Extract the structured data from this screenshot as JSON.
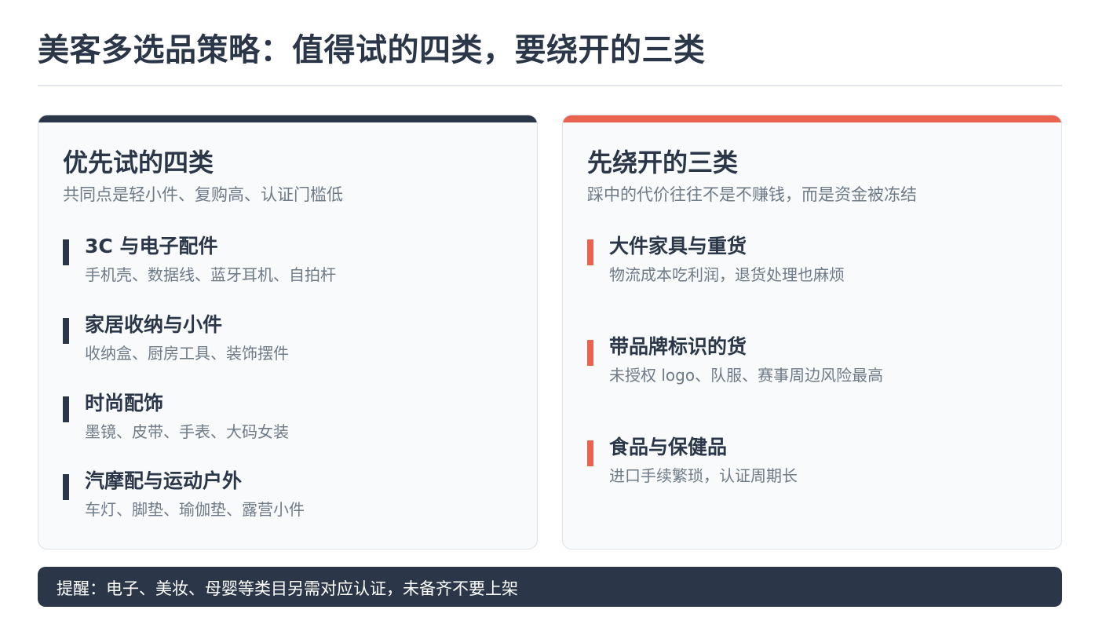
{
  "title": "美客多选品策略：值得试的四类，要绕开的三类",
  "colors": {
    "dark": "#2b3748",
    "accent": "#ea6351",
    "muted_text": "#6f7a87",
    "card_bg": "#f8fafc"
  },
  "recommended": {
    "heading": "优先试的四类",
    "subtitle": "共同点是轻小件、复购高、认证门槛低",
    "items": [
      {
        "title": "3C 与电子配件",
        "desc": "手机壳、数据线、蓝牙耳机、自拍杆"
      },
      {
        "title": "家居收纳与小件",
        "desc": "收纳盒、厨房工具、装饰摆件"
      },
      {
        "title": "时尚配饰",
        "desc": "墨镜、皮带、手表、大码女装"
      },
      {
        "title": "汽摩配与运动户外",
        "desc": "车灯、脚垫、瑜伽垫、露营小件"
      }
    ]
  },
  "avoid": {
    "heading": "先绕开的三类",
    "subtitle": "踩中的代价往往不是不赚钱，而是资金被冻结",
    "items": [
      {
        "title": "大件家具与重货",
        "desc": "物流成本吃利润，退货处理也麻烦"
      },
      {
        "title": "带品牌标识的货",
        "desc": "未授权 logo、队服、赛事周边风险最高"
      },
      {
        "title": "食品与保健品",
        "desc": "进口手续繁琐，认证周期长"
      }
    ]
  },
  "footer": {
    "note": "提醒：电子、美妆、母婴等类目另需对应认证，未备齐不要上架"
  }
}
